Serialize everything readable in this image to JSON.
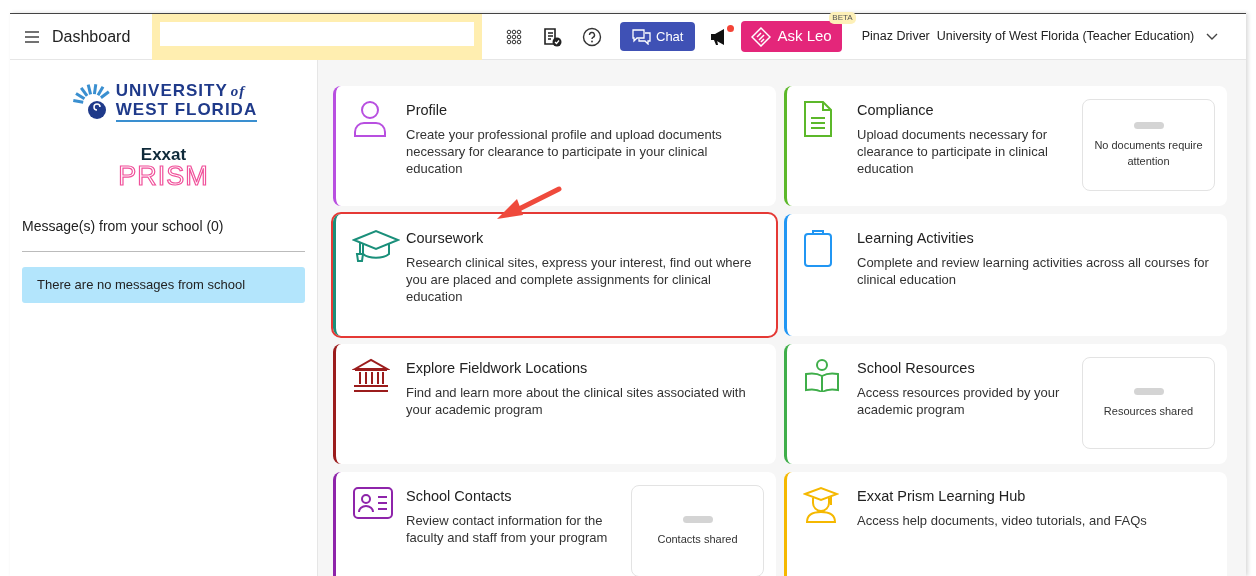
{
  "header": {
    "title": "Dashboard",
    "chat_button": "Chat",
    "notification_unread": true,
    "ask_button": "Ask Leo",
    "ask_badge": "BETA",
    "user_name": "Pinaz Driver",
    "institution": "University of West Florida (Teacher Education)"
  },
  "sidebar": {
    "school_logo": {
      "line_1": "UNIVERSITY",
      "line_1_suffix": "of",
      "line_2": "WEST FLORIDA"
    },
    "product_logo": {
      "brand": "Exxat",
      "product": "PRISM"
    },
    "messages_heading": "Message(s) from your school (0)",
    "messages_notice": "There are no messages from school"
  },
  "cards": [
    {
      "kind": "profile",
      "color": "#b84fe0",
      "title": "Profile",
      "description": "Create your professional profile and upload documents necessary for clearance to participate in your clinical education",
      "highlighted": false
    },
    {
      "kind": "compliance",
      "color": "#5cb82a",
      "title": "Compliance",
      "description": "Upload documents necessary for clearance to participate in clinical education",
      "panel": "No documents require attention",
      "highlighted": false
    },
    {
      "kind": "coursework",
      "color": "#1a8f7a",
      "title": "Coursework",
      "description": "Research clinical sites, express your interest, find out where you are placed and complete assignments for clinical education",
      "highlighted": true
    },
    {
      "kind": "activities",
      "color": "#2196f3",
      "title": "Learning Activities",
      "description": "Complete and review learning activities across all courses for clinical education",
      "highlighted": false
    },
    {
      "kind": "locations",
      "color": "#9b1c1c",
      "title": "Explore Fieldwork Locations",
      "description": "Find and learn more about the clinical sites associated with your academic program",
      "highlighted": false
    },
    {
      "kind": "resources",
      "color": "#3fae4a",
      "title": "School Resources",
      "description": "Access resources provided by your academic program",
      "panel": "Resources shared",
      "highlighted": false
    },
    {
      "kind": "contacts",
      "color": "#8e24aa",
      "title": "School Contacts",
      "description": "Review contact information for the faculty and staff from your program",
      "panel": "Contacts shared",
      "highlighted": false
    },
    {
      "kind": "hub",
      "color": "#f5b800",
      "title": "Exxat Prism Learning Hub",
      "description": "Access help documents, video tutorials, and FAQs",
      "highlighted": false
    }
  ]
}
